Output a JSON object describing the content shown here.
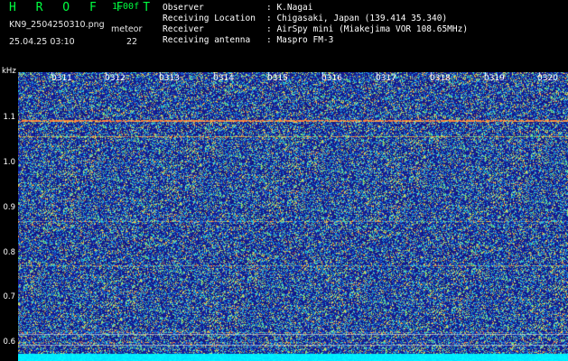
{
  "header": {
    "title": "H R O F F T",
    "version": "1.00f",
    "filename": "KN9_2504250310.png",
    "datetime": "25.04.25 03:10",
    "meteor_label": "meteor",
    "meteor_count": "22"
  },
  "info": [
    {
      "label": "Observer",
      "value": ": K.Nagai"
    },
    {
      "label": "Receiving Location",
      "value": ": Chigasaki, Japan (139.414 35.340)"
    },
    {
      "label": "Receiver",
      "value": ": AirSpy mini (Miakejima VOR 108.65MHz)"
    },
    {
      "label": "Receiving antenna",
      "value": ": Maspro FM-3"
    }
  ],
  "axis": {
    "y_unit": "kHz",
    "y_ticks": [
      "1.1",
      "1.0",
      "0.9",
      "0.8",
      "0.7",
      "0.6"
    ],
    "x_ticks": [
      "0311",
      "0312",
      "0313",
      "0314",
      "0315",
      "0316",
      "0317",
      "0318",
      "0319",
      "0320"
    ]
  },
  "colors": {
    "background": "#000000",
    "noise_base": "#1a1a9a",
    "title": "#00ff40",
    "carrier_line": "#ff8040",
    "bottom_band": "#00e0ff"
  }
}
